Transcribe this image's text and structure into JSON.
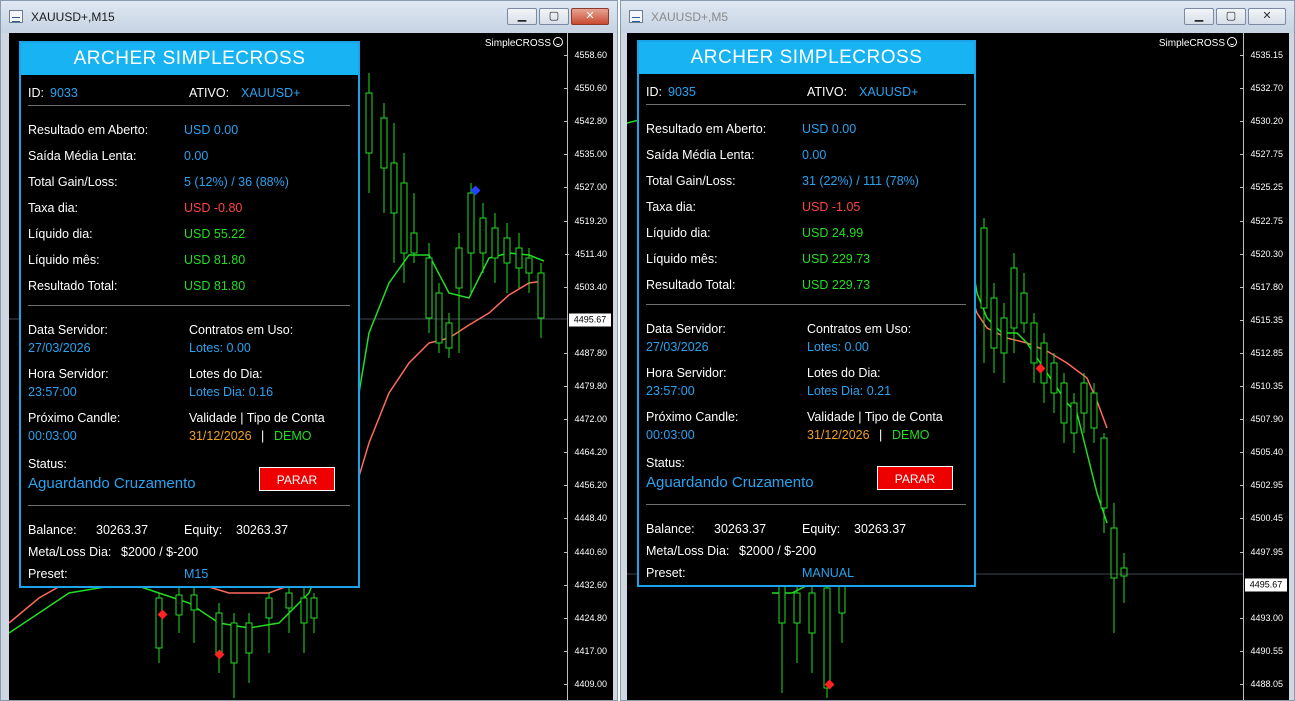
{
  "windows": [
    {
      "title": "XAUUSD+,M15",
      "ea_label": "SimpleCROSS",
      "axis_ticks": [
        "4558.60",
        "4550.60",
        "4542.80",
        "4535.00",
        "4527.00",
        "4519.20",
        "4511.40",
        "4503.40",
        "4495.67",
        "4487.80",
        "4479.80",
        "4472.00",
        "4464.20",
        "4456.20",
        "4448.40",
        "4440.60",
        "4432.60",
        "4424.80",
        "4417.00",
        "4409.00"
      ],
      "current_price": "4495.67",
      "panel": {
        "title": "ARCHER SIMPLECROSS",
        "id_label": "ID:",
        "id_value": "9033",
        "ativo_label": "ATIVO:",
        "ativo_value": "XAUUSD+",
        "resultado_aberto_label": "Resultado em Aberto:",
        "resultado_aberto_value": "USD 0.00",
        "saida_label": "Saída Média Lenta:",
        "saida_value": "0.00",
        "gainloss_label": "Total Gain/Loss:",
        "gainloss_value": "5 (12%) / 36 (88%)",
        "taxa_label": "Taxa dia:",
        "taxa_value": "USD -0.80",
        "liquido_dia_label": "Líquido dia:",
        "liquido_dia_value": "USD 55.22",
        "liquido_mes_label": "Líquido mês:",
        "liquido_mes_value": "USD 81.80",
        "resultado_total_label": "Resultado Total:",
        "resultado_total_value": "USD 81.80",
        "data_servidor_label": "Data Servidor:",
        "data_servidor_value": "27/03/2026",
        "contratos_label": "Contratos em Uso:",
        "contratos_value": "Lotes: 0.00",
        "hora_label": "Hora Servidor:",
        "hora_value": "23:57:00",
        "lotes_dia_label": "Lotes do Dia:",
        "lotes_dia_value": "Lotes Dia: 0.16",
        "proximo_label": "Próximo Candle:",
        "proximo_value": "00:03:00",
        "validade_label": "Validade | Tipo de Conta",
        "validade_date": "31/12/2026",
        "validade_sep": "|",
        "tipo_conta": "DEMO",
        "status_label": "Status:",
        "status_value": "Aguardando Cruzamento",
        "parar_label": "PARAR",
        "balance_label": "Balance:",
        "balance_value": "30263.37",
        "equity_label": "Equity:",
        "equity_value": "30263.37",
        "meta_label": "Meta/Loss Dia:",
        "meta_value": "$2000 / $-200",
        "preset_label": "Preset:",
        "preset_value": "M15"
      }
    },
    {
      "title": "XAUUSD+,M5",
      "ea_label": "SimpleCROSS",
      "axis_ticks": [
        "4535.15",
        "4532.70",
        "4530.20",
        "4527.75",
        "4525.25",
        "4522.75",
        "4520.30",
        "4517.80",
        "4515.35",
        "4512.85",
        "4510.35",
        "4507.90",
        "4505.40",
        "4502.95",
        "4500.45",
        "4497.95",
        "4495.67",
        "4493.00",
        "4490.55",
        "4488.05"
      ],
      "current_price": "4495.67",
      "panel": {
        "title": "ARCHER SIMPLECROSS",
        "id_label": "ID:",
        "id_value": "9035",
        "ativo_label": "ATIVO:",
        "ativo_value": "XAUUSD+",
        "resultado_aberto_label": "Resultado em Aberto:",
        "resultado_aberto_value": "USD 0.00",
        "saida_label": "Saída Média Lenta:",
        "saida_value": "0.00",
        "gainloss_label": "Total Gain/Loss:",
        "gainloss_value": "31 (22%) / 111 (78%)",
        "taxa_label": "Taxa dia:",
        "taxa_value": "USD -1.05",
        "liquido_dia_label": "Líquido dia:",
        "liquido_dia_value": "USD 24.99",
        "liquido_mes_label": "Líquido mês:",
        "liquido_mes_value": "USD 229.73",
        "resultado_total_label": "Resultado Total:",
        "resultado_total_value": "USD 229.73",
        "data_servidor_label": "Data Servidor:",
        "data_servidor_value": "27/03/2026",
        "contratos_label": "Contratos em Uso:",
        "contratos_value": "Lotes: 0.00",
        "hora_label": "Hora Servidor:",
        "hora_value": "23:57:00",
        "lotes_dia_label": "Lotes do Dia:",
        "lotes_dia_value": "Lotes Dia: 0.21",
        "proximo_label": "Próximo Candle:",
        "proximo_value": "00:03:00",
        "validade_label": "Validade | Tipo de Conta",
        "validade_date": "31/12/2026",
        "validade_sep": "|",
        "tipo_conta": "DEMO",
        "status_label": "Status:",
        "status_value": "Aguardando Cruzamento",
        "parar_label": "PARAR",
        "balance_label": "Balance:",
        "balance_value": "30263.37",
        "equity_label": "Equity:",
        "equity_value": "30263.37",
        "meta_label": "Meta/Loss Dia:",
        "meta_value": "$2000 / $-200",
        "preset_label": "Preset:",
        "preset_value": "MANUAL"
      }
    }
  ],
  "colors": {
    "panel_border": "#1aa3e8",
    "header_bg": "#17b3f2",
    "value_blue": "#29a3f0",
    "loss_red": "#ff4444",
    "profit_green": "#22dd22",
    "date_orange": "#f0a020",
    "button_red": "#ee0000",
    "fast_ma": "#22dd22",
    "slow_ma": "#ff6a5a"
  }
}
